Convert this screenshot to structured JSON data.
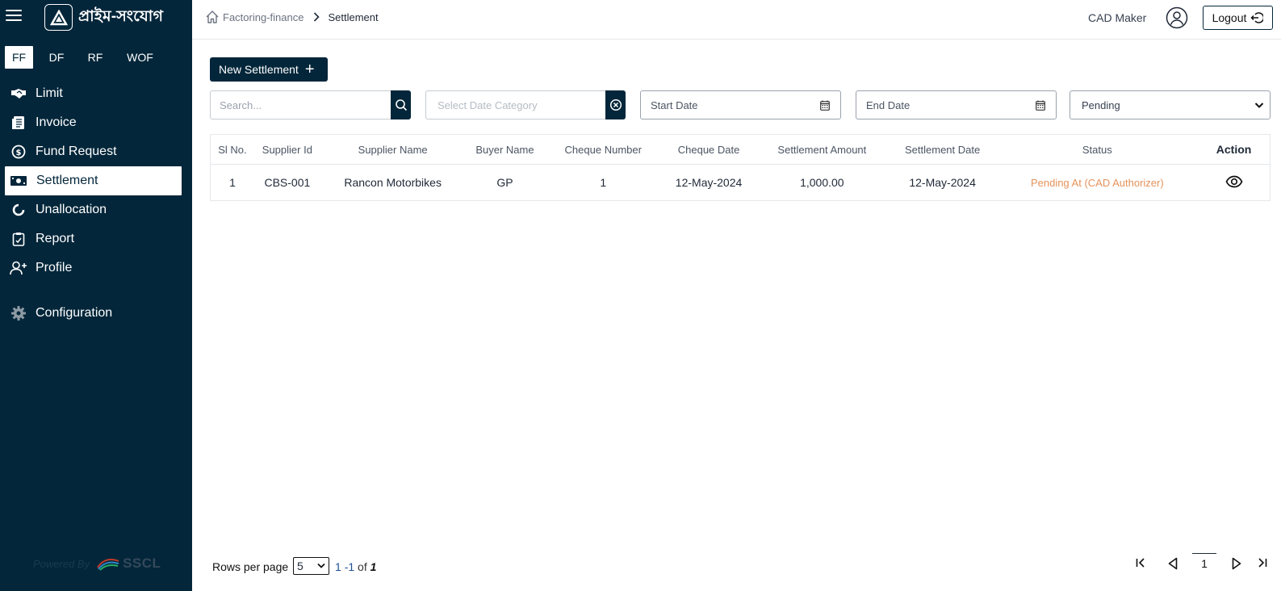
{
  "app": {
    "title": "প্রাইম-সংযোগ"
  },
  "sidebar": {
    "type_tabs": [
      {
        "label": "FF",
        "active": true
      },
      {
        "label": "DF",
        "active": false
      },
      {
        "label": "RF",
        "active": false
      },
      {
        "label": "WOF",
        "active": false
      }
    ],
    "items": [
      {
        "label": "Limit",
        "icon": "handshake-icon"
      },
      {
        "label": "Invoice",
        "icon": "invoice-icon"
      },
      {
        "label": "Fund Request",
        "icon": "fund-icon"
      },
      {
        "label": "Settlement",
        "icon": "cash-icon",
        "active": true
      },
      {
        "label": "Unallocation",
        "icon": "circle-icon"
      },
      {
        "label": "Report",
        "icon": "clipboard-icon"
      },
      {
        "label": "Profile",
        "icon": "user-add-icon"
      },
      {
        "label": "Configuration",
        "icon": "gear-icon"
      }
    ],
    "powered_by": "Powered By",
    "powered_brand": "SSCL"
  },
  "header": {
    "breadcrumb_home": "Factoring-finance",
    "breadcrumb_current": "Settlement",
    "user_name": "CAD Maker",
    "logout_label": "Logout"
  },
  "toolbar": {
    "new_button_label": "New Settlement",
    "search_placeholder": "Search...",
    "date_category_placeholder": "Select Date Category",
    "start_date_label": "Start Date",
    "end_date_label": "End Date",
    "status_selected": "Pending"
  },
  "table": {
    "columns": [
      "Sl No.",
      "Supplier Id",
      "Supplier Name",
      "Buyer Name",
      "Cheque Number",
      "Cheque Date",
      "Settlement Amount",
      "Settlement Date",
      "Status",
      "Action"
    ],
    "rows": [
      {
        "sl_no": "1",
        "supplier_id": "CBS-001",
        "supplier_name": "Rancon Motorbikes",
        "buyer_name": "GP",
        "cheque_number": "1",
        "cheque_date": "12-May-2024",
        "settlement_amount": "1,000.00",
        "settlement_date": "12-May-2024",
        "status": "Pending At (CAD Authorizer)",
        "status_color": "#e5925a"
      }
    ]
  },
  "pagination": {
    "rows_per_page_label": "Rows per page",
    "rows_per_page_value": "5",
    "range_start": "1",
    "range_sep": "-1",
    "of_label": "of",
    "total": "1",
    "current_page": "1"
  },
  "colors": {
    "sidebar_bg": "#03263a",
    "accent": "#03263a",
    "pending_status": "#e5925a"
  }
}
